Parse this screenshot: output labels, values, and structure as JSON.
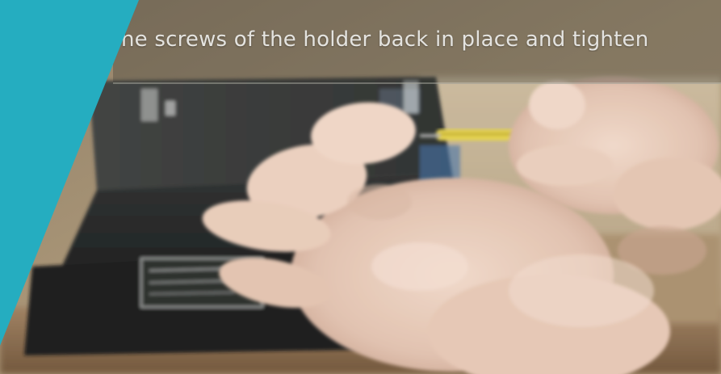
{
  "caption": {
    "text": "he screws of the holder back in place and tighten"
  },
  "colors": {
    "accent_teal": "#25adc0",
    "device_black": "#1d1f1f",
    "table_tan": "#a48e6c",
    "wall_beige": "#bfae92",
    "skin": "#e4c7b6",
    "screwdriver_yellow": "#e6d24a"
  }
}
